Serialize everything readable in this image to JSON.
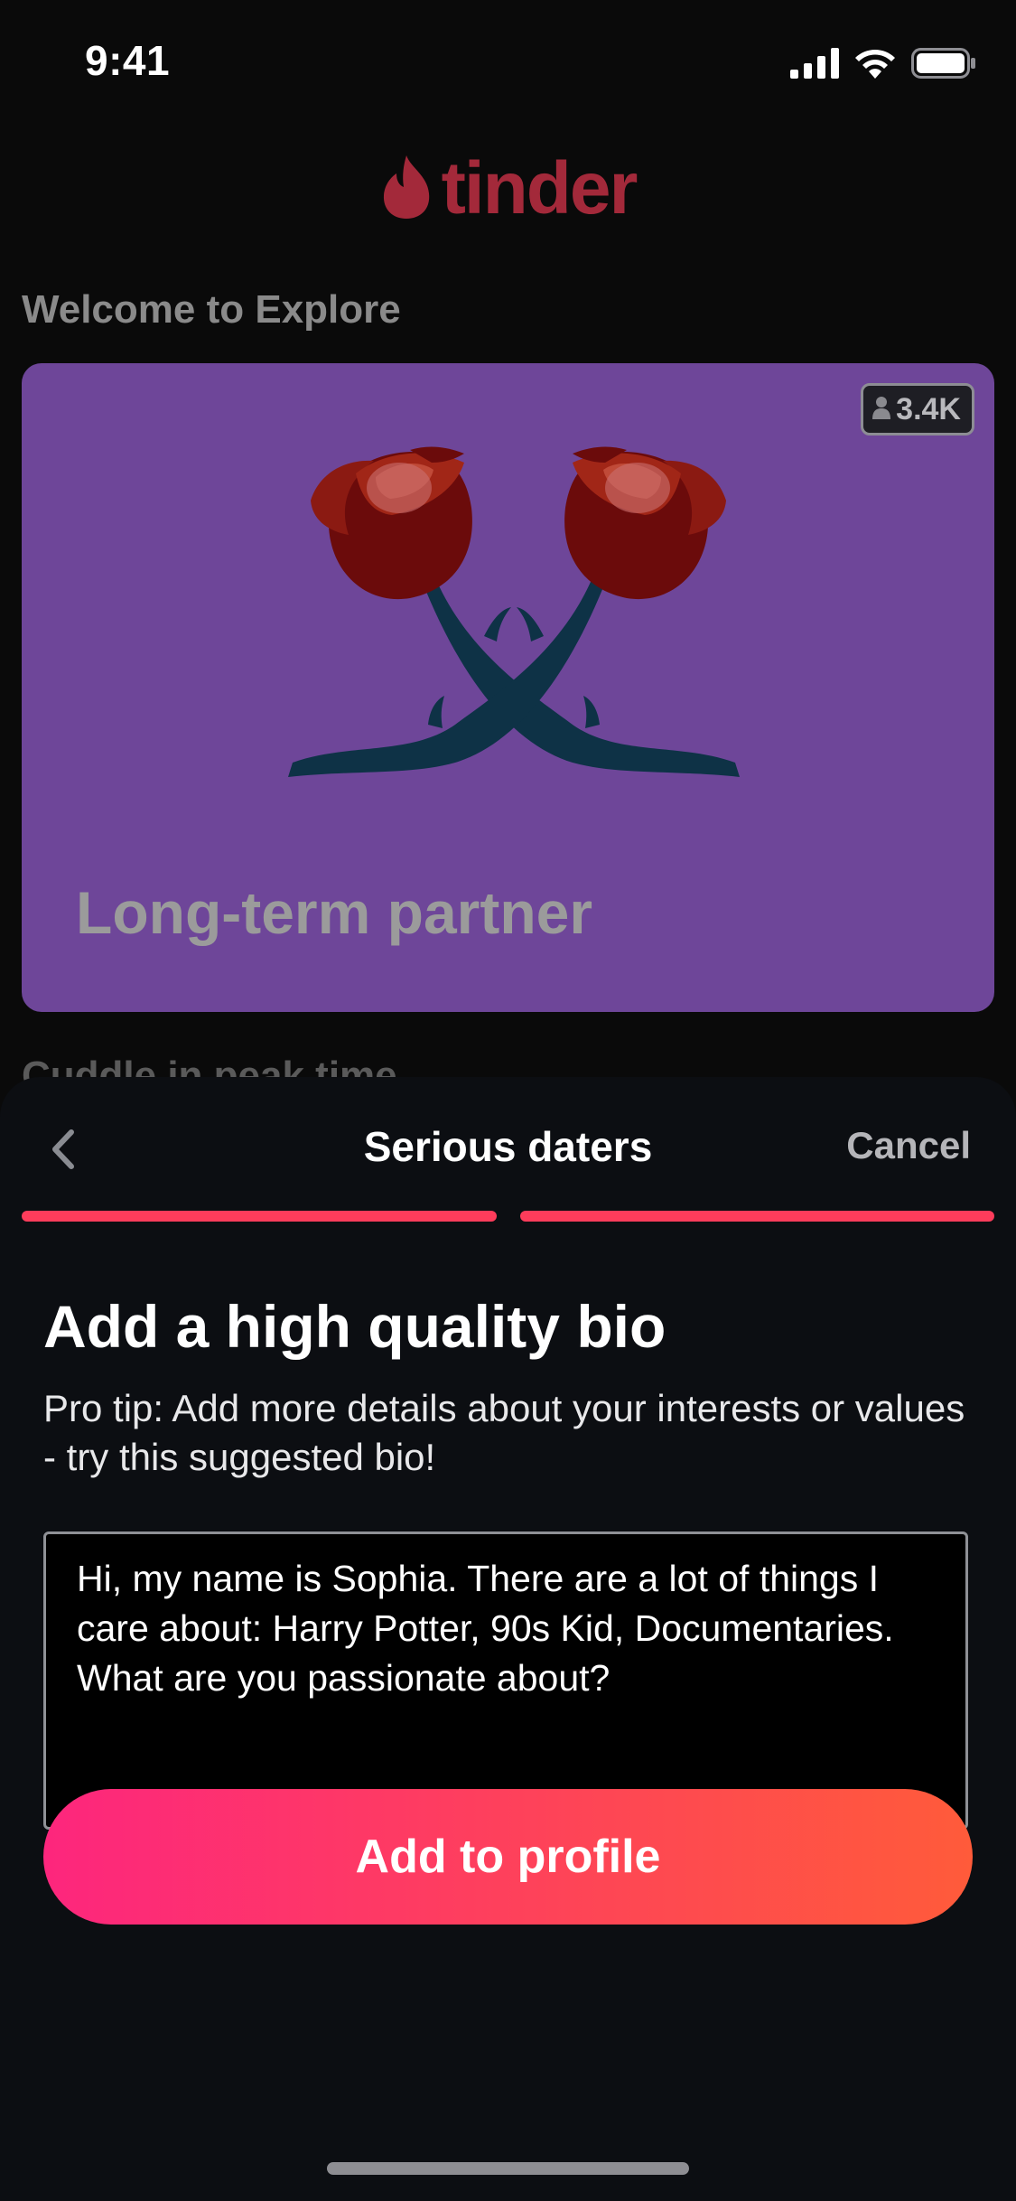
{
  "status_bar": {
    "time": "9:41"
  },
  "explore": {
    "brand": "tinder",
    "section_title": "Welcome to Explore",
    "card": {
      "title": "Long-term partner",
      "member_count": "3.4K"
    },
    "next_section_peek": "Cuddle in peak time"
  },
  "sheet": {
    "title": "Serious daters",
    "cancel_label": "Cancel",
    "progress": {
      "completed_steps": 2,
      "total_steps": 2
    },
    "heading": "Add a high quality bio",
    "tip": "Pro tip: Add more details about your interests or values - try this suggested bio!",
    "bio_value": "Hi, my name is Sophia. There are a lot of things I care about: Harry Potter, 90s Kid, Documentaries. What are you passionate about?",
    "primary_button": "Add to profile"
  },
  "colors": {
    "brand": "#fe3c5b",
    "card_bg": "#6e4699",
    "button_gradient_start": "#fd267d",
    "button_gradient_end": "#ff5b3a"
  },
  "icons": [
    "signal-icon",
    "wifi-icon",
    "battery-icon",
    "flame-icon",
    "person-icon",
    "roses-illustration",
    "chevron-left-icon"
  ]
}
